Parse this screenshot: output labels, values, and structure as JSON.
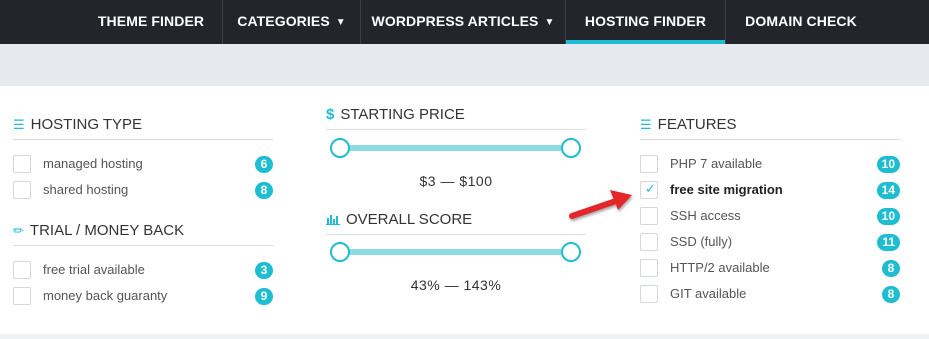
{
  "nav": {
    "items": [
      {
        "label": "THEME FINDER"
      },
      {
        "label": "CATEGORIES",
        "chevron": "chevron-down-icon"
      },
      {
        "label": "WORDPRESS ARTICLES",
        "chevron": "chevron-down-icon"
      },
      {
        "label": "HOSTING FINDER",
        "active": true
      },
      {
        "label": "DOMAIN CHECK"
      }
    ]
  },
  "hosting_type": {
    "title": "HOSTING TYPE",
    "icon": "server-icon",
    "options": [
      {
        "label": "managed hosting",
        "count": "6",
        "checked": false
      },
      {
        "label": "shared hosting",
        "count": "8",
        "checked": false
      }
    ]
  },
  "trial": {
    "title": "TRIAL / MONEY BACK",
    "icon": "magic-wand-icon",
    "options": [
      {
        "label": "free trial available",
        "count": "3",
        "checked": false
      },
      {
        "label": "money back guaranty",
        "count": "9",
        "checked": false
      }
    ]
  },
  "starting_price": {
    "title": "STARTING PRICE",
    "icon": "dollar-icon",
    "range": "$3 — $100"
  },
  "overall_score": {
    "title": "OVERALL SCORE",
    "icon": "bar-chart-icon",
    "range": "43% — 143%"
  },
  "features": {
    "title": "FEATURES",
    "icon": "server-icon",
    "options": [
      {
        "label": "PHP 7 available",
        "count": "10",
        "checked": false
      },
      {
        "label": "free site migration",
        "count": "14",
        "checked": true
      },
      {
        "label": "SSH access",
        "count": "10",
        "checked": false
      },
      {
        "label": "SSD (fully)",
        "count": "11",
        "checked": false
      },
      {
        "label": "HTTP/2 available",
        "count": "8",
        "checked": false
      },
      {
        "label": "GIT available",
        "count": "8",
        "checked": false
      }
    ]
  },
  "colors": {
    "accent": "#1ebdd1",
    "nav_bg": "#22262b",
    "annotation_arrow": "#e3262a"
  }
}
